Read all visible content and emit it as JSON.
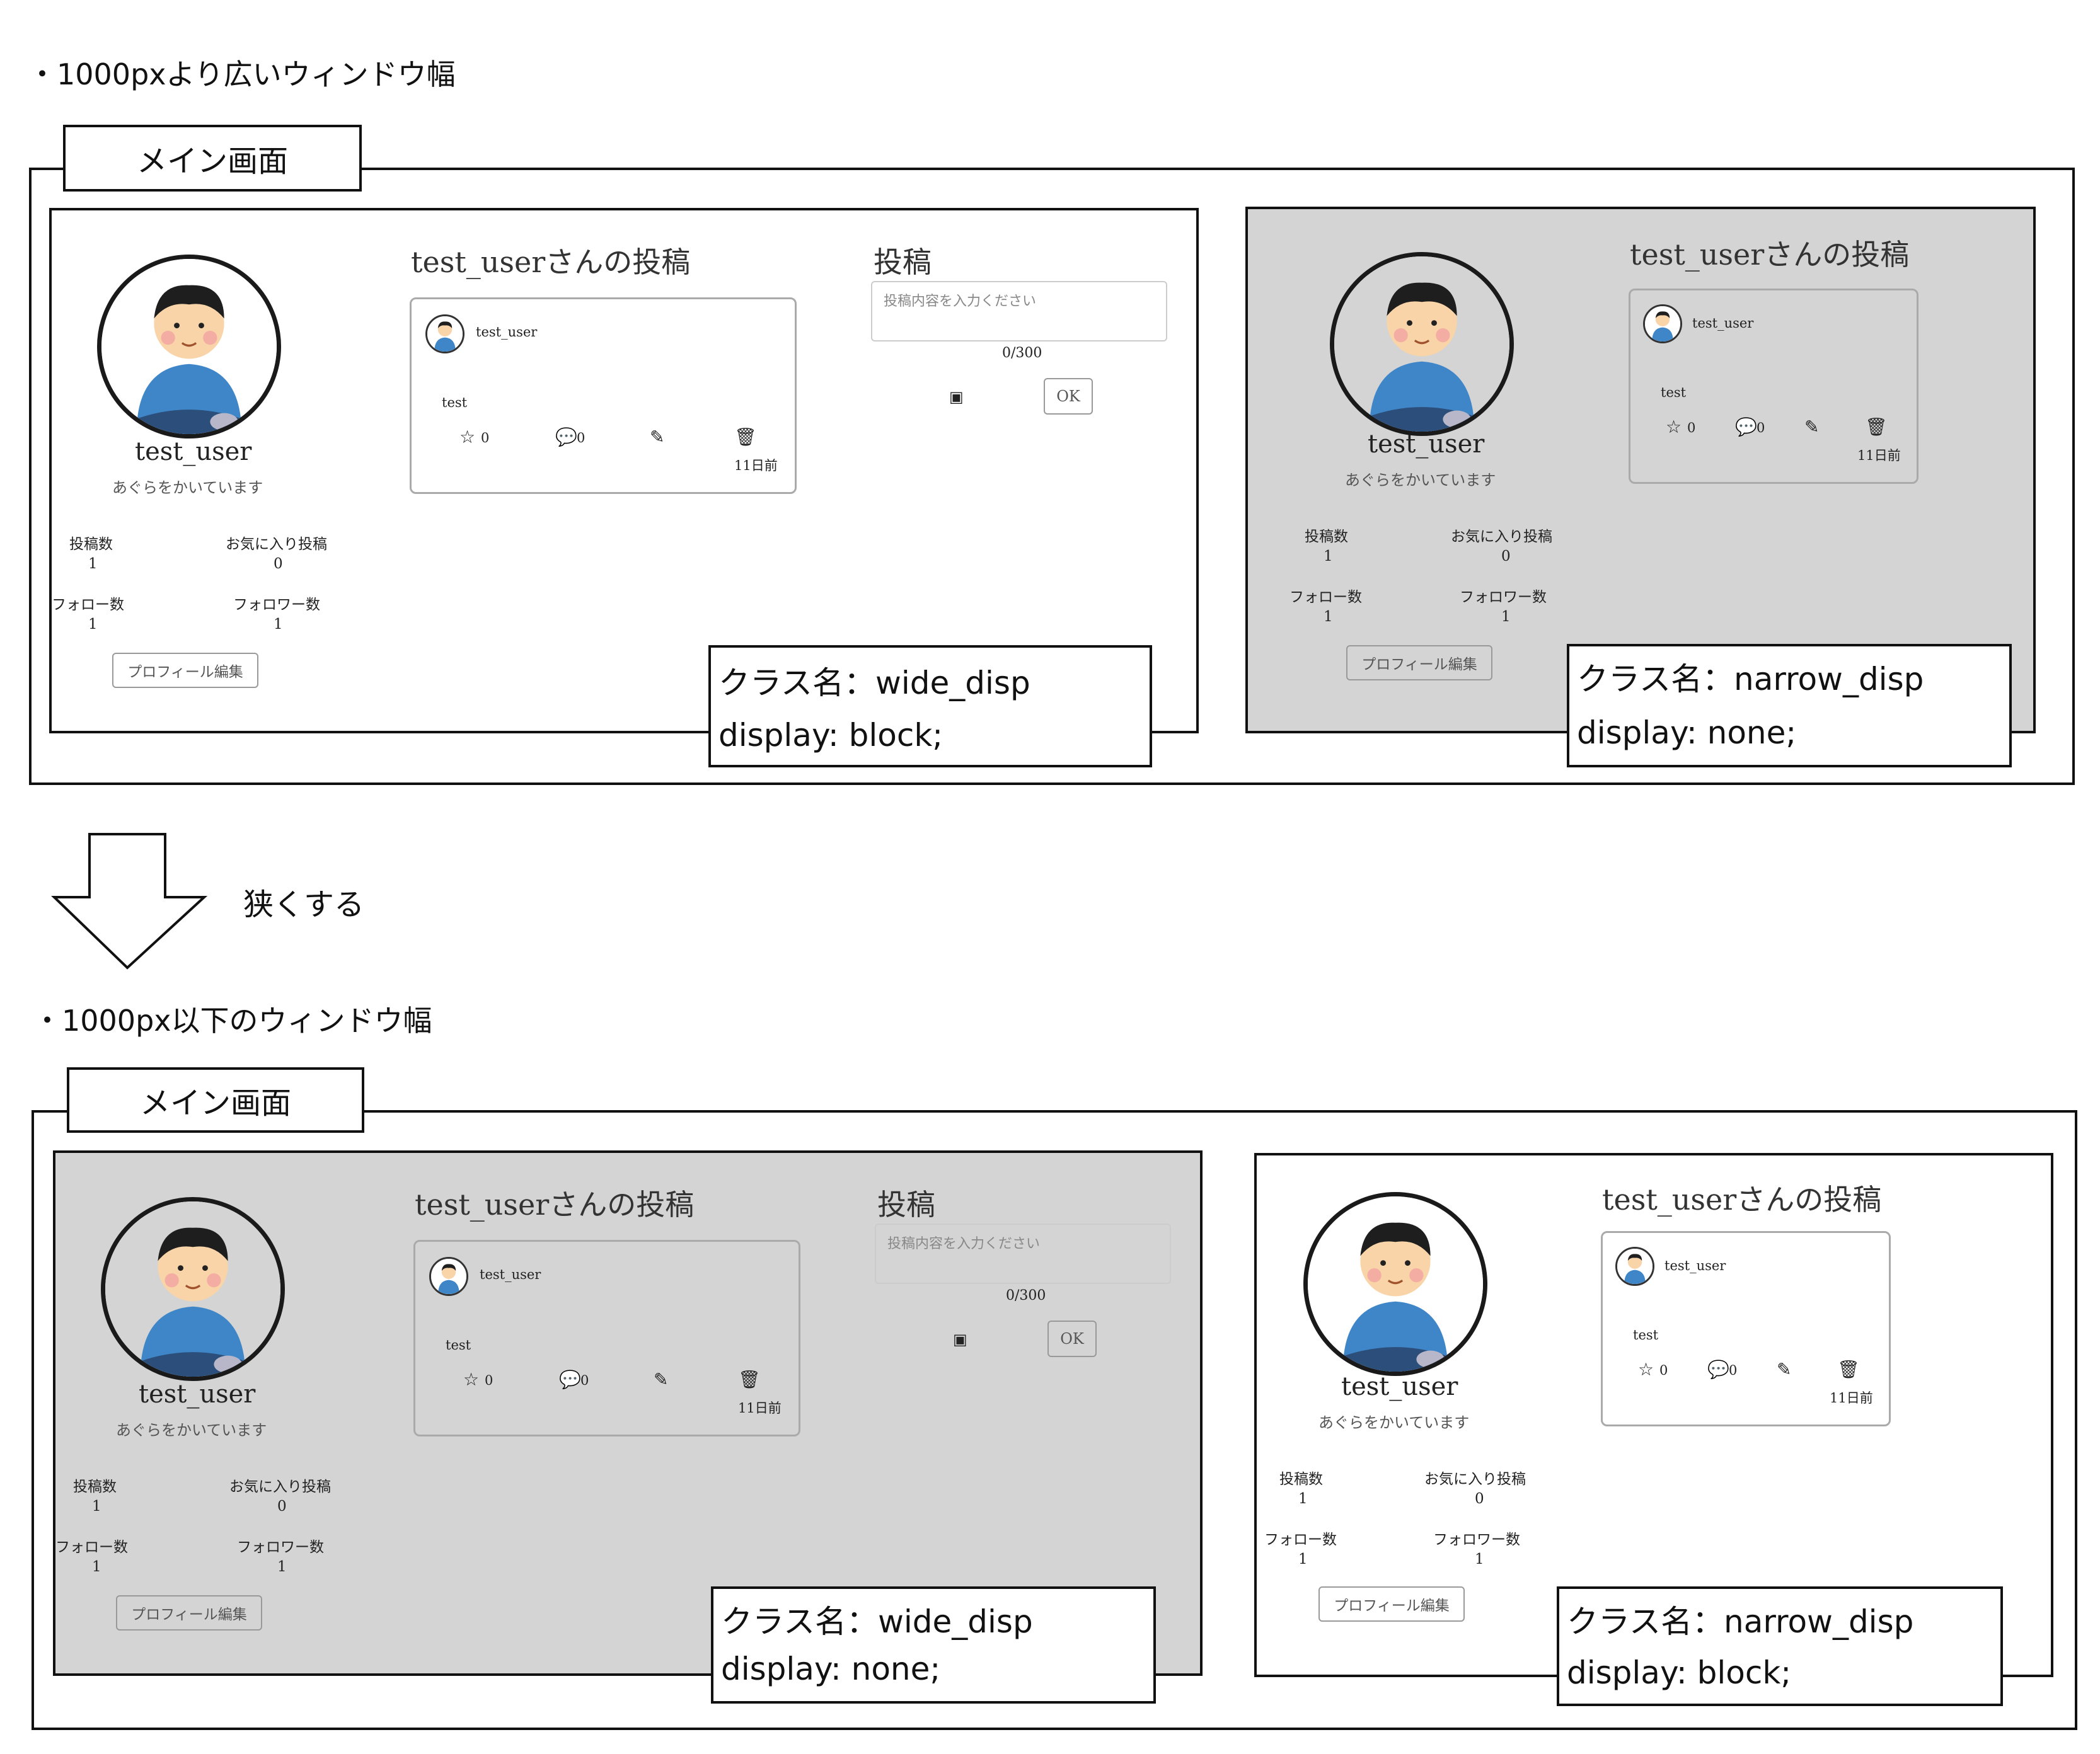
{
  "section1": {
    "heading": "・1000pxより広いウィンドウ幅",
    "tab_label": "メイン画面"
  },
  "section2": {
    "heading": "・1000px以下のウィンドウ幅",
    "tab_label": "メイン画面"
  },
  "arrow_label": "狭くする",
  "profile": {
    "username": "test_user",
    "bio": "あぐらをかいています",
    "stats": [
      {
        "label": "投稿数",
        "value": "1"
      },
      {
        "label": "お気に入り投稿",
        "value": "0"
      },
      {
        "label": "フォロー数",
        "value": "1"
      },
      {
        "label": "フォロワー数",
        "value": "1"
      }
    ],
    "edit_button": "プロフィール編集"
  },
  "posts": {
    "title": "test_userさんの投稿",
    "card": {
      "username": "test_user",
      "body": "test",
      "likes": "0",
      "comments": "0",
      "date": "11日前"
    }
  },
  "compose": {
    "title": "投稿",
    "placeholder": "投稿内容を入力ください",
    "counter": "0/300",
    "ok_button": "OK"
  },
  "notes": {
    "wide_block": {
      "line1": "クラス名：wide_disp",
      "line2": "display: block;"
    },
    "narrow_none": {
      "line1": "クラス名：narrow_disp",
      "line2": "display: none;"
    },
    "wide_none": {
      "line1": "クラス名：wide_disp",
      "line2": "display: none;"
    },
    "narrow_block": {
      "line1": "クラス名：narrow_disp",
      "line2": "display: block;"
    }
  },
  "colors": {
    "hidden_panel_bg": "#d4d4d4",
    "avatar_shirt": "#3f86c8",
    "avatar_skin": "#f8d4a8"
  }
}
